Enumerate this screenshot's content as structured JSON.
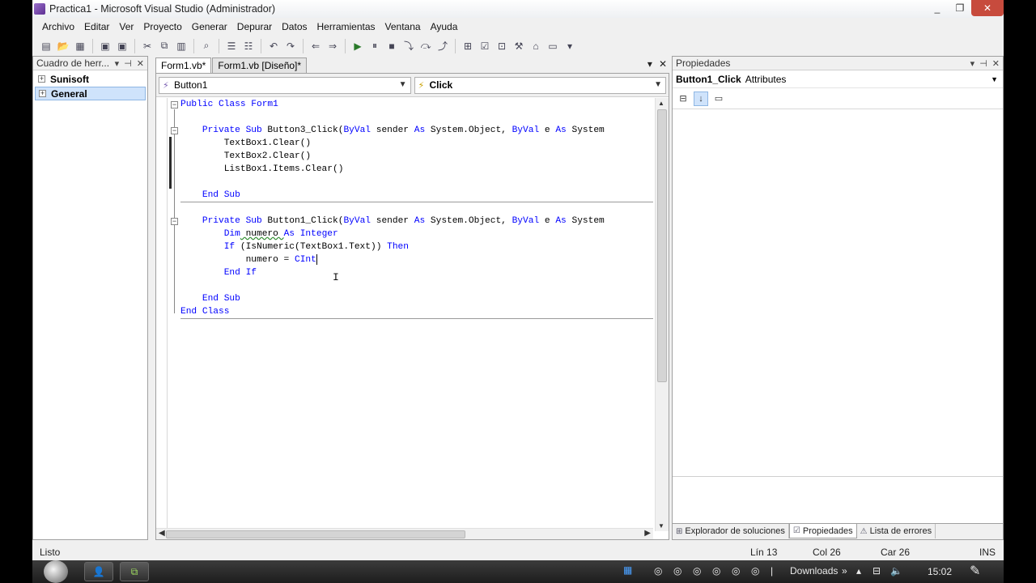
{
  "window": {
    "title": "Practica1 - Microsoft Visual Studio (Administrador)",
    "buttons": {
      "minimize": "_",
      "maximize": "❐",
      "close": "✕"
    }
  },
  "menu": [
    "Archivo",
    "Editar",
    "Ver",
    "Proyecto",
    "Generar",
    "Depurar",
    "Datos",
    "Herramientas",
    "Ventana",
    "Ayuda"
  ],
  "toolbox": {
    "title": "Cuadro de herr...",
    "sections": [
      {
        "label": "Sunisoft",
        "selected": false
      },
      {
        "label": "General",
        "selected": true
      }
    ]
  },
  "editor": {
    "tabs": [
      {
        "label": "Form1.vb*",
        "active": true
      },
      {
        "label": "Form1.vb [Diseño]*",
        "active": false
      }
    ],
    "object_combo": "Button1",
    "event_combo": "Click",
    "code": {
      "l1": "Public Class Form1",
      "l2_kw": "    Private Sub",
      "l2_rest": " Button3_Click(",
      "l2_byval": "ByVal",
      "l2_rest2": " sender ",
      "l2_as": "As",
      "l2_rest3": " System.Object, ",
      "l2_byval2": "ByVal",
      "l2_rest4": " e ",
      "l2_as2": "As",
      "l2_rest5": " System",
      "l3": "        TextBox1.Clear()",
      "l4": "        TextBox2.Clear()",
      "l5": "        ListBox1.Items.Clear()",
      "l6": "    End Sub",
      "l7_kw": "    Private Sub",
      "l7_rest": " Button1_Click(",
      "l7_byval": "ByVal",
      "l7_rest2": " sender ",
      "l7_as": "As",
      "l7_rest3": " System.Object, ",
      "l7_byval2": "ByVal",
      "l7_rest4": " e ",
      "l7_as2": "As",
      "l7_rest5": " System",
      "l8_kw": "        Dim",
      "l8_rest": " numero ",
      "l8_kw2": "As Integer",
      "l9_kw": "        If",
      "l9_rest": " (IsNumeric(TextBox1.Text)) ",
      "l9_kw2": "Then",
      "l10_rest": "            numero = ",
      "l10_kw": "CInt",
      "l11": "        End If",
      "l12": "    End Sub",
      "l13": "End Class"
    }
  },
  "properties": {
    "title": "Propiedades",
    "object_name": "Button1_Click",
    "object_type": "Attributes",
    "bottom_tabs": [
      {
        "label": "Explorador de soluciones",
        "active": false
      },
      {
        "label": "Propiedades",
        "active": true
      },
      {
        "label": "Lista de errores",
        "active": false
      }
    ]
  },
  "status": {
    "ready": "Listo",
    "line": "Lín 13",
    "col": "Col 26",
    "car": "Car 26",
    "mode": "INS"
  },
  "taskbar": {
    "downloads": "Downloads",
    "time": "15:02"
  }
}
